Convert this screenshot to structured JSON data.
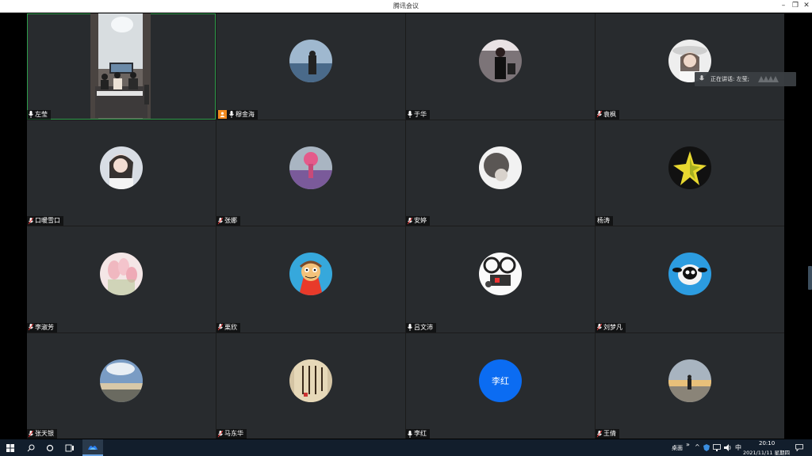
{
  "window": {
    "title": "腾讯会议",
    "minimize_icon": "minimize-icon",
    "restore_icon": "restore-icon",
    "close_icon": "close-icon"
  },
  "participants": [
    {
      "name": "左莹",
      "type": "video"
    },
    {
      "name": "穆金海",
      "type": "avatar",
      "host": true
    },
    {
      "name": "于华",
      "type": "avatar"
    },
    {
      "name": "袁枫",
      "type": "avatar"
    },
    {
      "name": "口暖雪口",
      "type": "avatar"
    },
    {
      "name": "张娜",
      "type": "avatar"
    },
    {
      "name": "安婷",
      "type": "avatar"
    },
    {
      "name": "杨涛",
      "type": "avatar",
      "no_mic": true
    },
    {
      "name": "李淑芳",
      "type": "avatar"
    },
    {
      "name": "栗欣",
      "type": "avatar"
    },
    {
      "name": "吕文沛",
      "type": "avatar"
    },
    {
      "name": "刘梦凡",
      "type": "avatar"
    },
    {
      "name": "张天银",
      "type": "avatar"
    },
    {
      "name": "马东华",
      "type": "avatar"
    },
    {
      "name": "李红",
      "type": "text-avatar",
      "avatar_text": "李红"
    },
    {
      "name": "王倩",
      "type": "avatar"
    }
  ],
  "speaking": {
    "label": "正在讲话: 左莹;"
  },
  "taskbar": {
    "desktop_label": "桌面",
    "ime_label": "中",
    "time": "20:10",
    "date": "2021/11/11 星期四",
    "accent": "#0b6cf2"
  }
}
